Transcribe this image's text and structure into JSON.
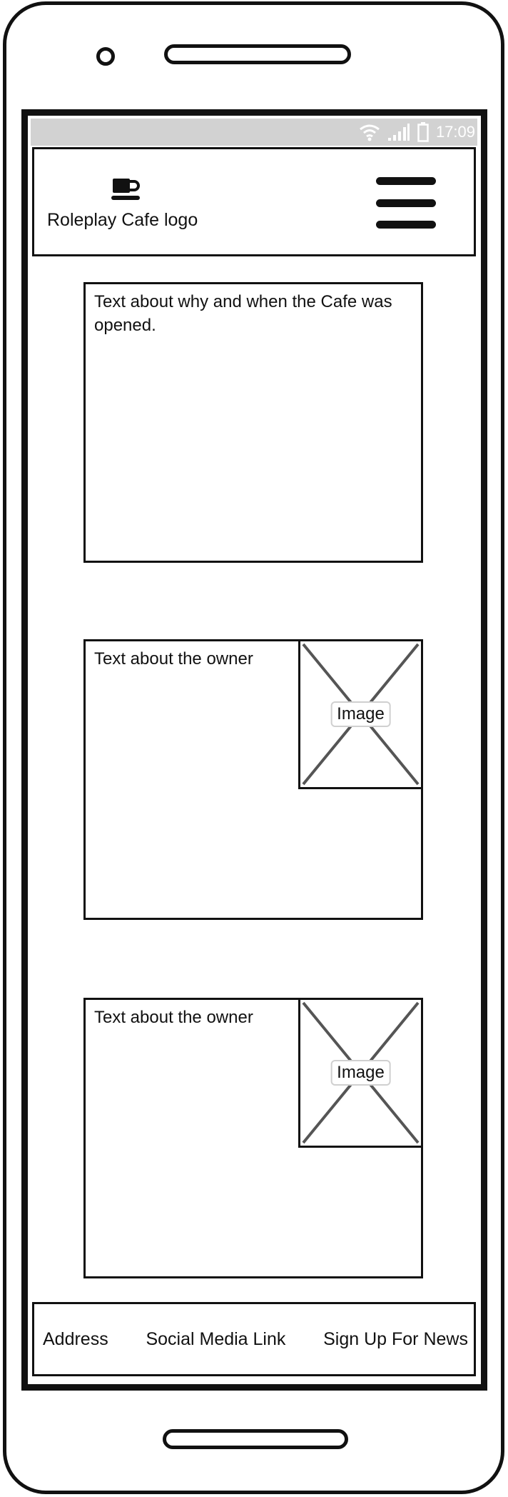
{
  "status_bar": {
    "time": "17:09",
    "icons": [
      "wifi-icon",
      "signal-icon",
      "battery-icon"
    ]
  },
  "header": {
    "logo_icon": "coffee-cup-icon",
    "logo_label": "Roleplay Cafe logo",
    "menu_icon": "hamburger-menu-icon"
  },
  "main": {
    "about_cafe": {
      "text": "Text about why and when the Cafe was opened."
    },
    "owners": [
      {
        "text": "Text about the owner",
        "image_label": "Image"
      },
      {
        "text": "Text about the owner",
        "image_label": "Image"
      }
    ]
  },
  "footer": {
    "links": [
      "Address",
      "Social Media Link",
      "Sign Up For News"
    ]
  }
}
